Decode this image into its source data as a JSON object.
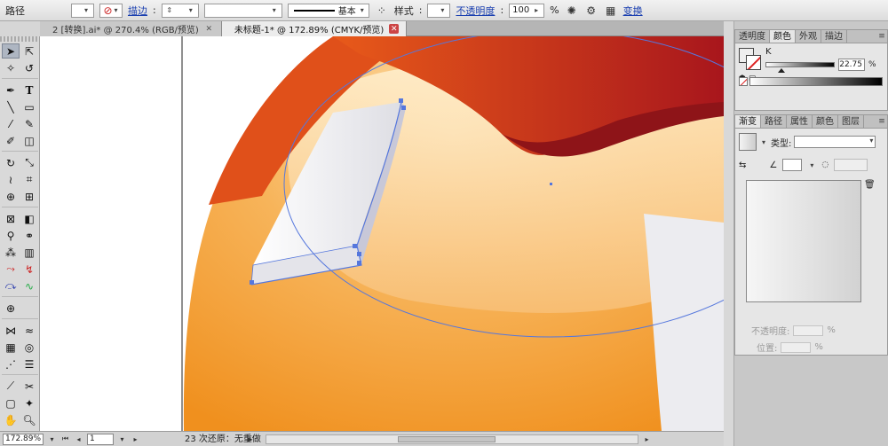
{
  "control_bar": {
    "object_type": "路径",
    "stroke_link": "描边",
    "stroke_profile": "基本",
    "style_label": "样式",
    "opacity_link": "不透明度",
    "opacity_value": "100",
    "opacity_unit": "%",
    "transform_link": "变换"
  },
  "tabs": [
    {
      "label": "2 [转换].ai* @ 270.4% (RGB/预览)",
      "active": false
    },
    {
      "label": "未标题-1* @ 172.89% (CMYK/预览)",
      "active": true
    }
  ],
  "color_panel": {
    "tabs": [
      "透明度",
      "颜色",
      "外观",
      "描边"
    ],
    "active_tab": "颜色",
    "k_label": "K",
    "k_value": "22.75",
    "k_unit": "%",
    "k_level": 0.2275
  },
  "gradient_panel": {
    "tabs": [
      "渐变",
      "路径",
      "属性",
      "颜色",
      "图层"
    ],
    "active_tab": "渐变",
    "type_label": "类型:",
    "opacity_label": "不透明度:",
    "location_label": "位置:",
    "pct": "%"
  },
  "status_bar": {
    "zoom": "172.89%",
    "page": "1",
    "status_text": "23 次还原：无重做"
  },
  "icons": {
    "selection": "selection-arrow-icon",
    "direct_selection": "direct-selection-icon",
    "pen": "pen-icon",
    "type": "type-icon"
  },
  "colors": {
    "art_orange_dark": "#e0501a",
    "art_red": "#b81b1b",
    "art_orange": "#f39a2a",
    "art_cream": "#ffe2b0",
    "path_selection": "#5577dd"
  }
}
